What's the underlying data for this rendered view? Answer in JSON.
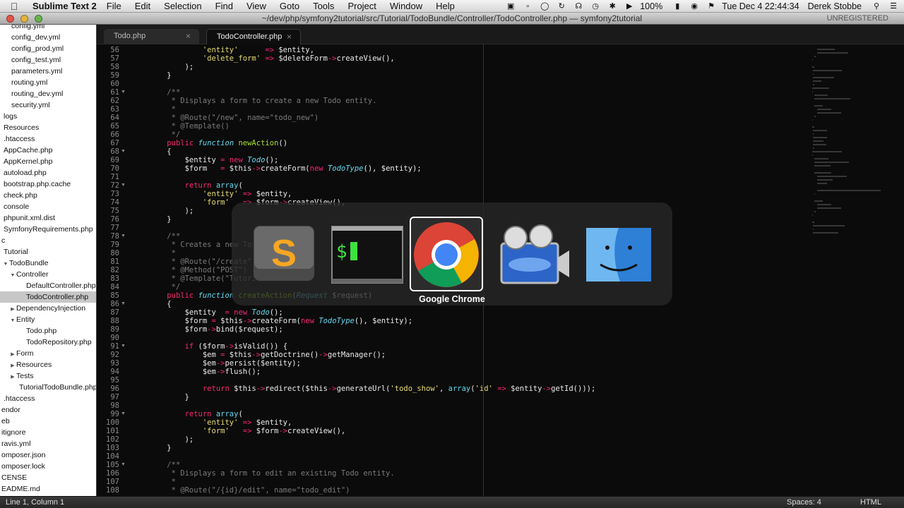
{
  "menubar": {
    "app_name": "Sublime Text 2",
    "items": [
      "File",
      "Edit",
      "Selection",
      "Find",
      "View",
      "Goto",
      "Tools",
      "Project",
      "Window",
      "Help"
    ],
    "battery": "100%",
    "clock": "Tue Dec 4  22:44:34",
    "user": "Derek Stobbe"
  },
  "window": {
    "title": "~/dev/php/symfony2tutorial/src/Tutorial/TodoBundle/Controller/TodoController.php — symfony2tutorial",
    "license": "UNREGISTERED"
  },
  "sidebar": {
    "items": [
      {
        "label": "config.yml",
        "indent": 16,
        "arrow": ""
      },
      {
        "label": "config_dev.yml",
        "indent": 16,
        "arrow": ""
      },
      {
        "label": "config_prod.yml",
        "indent": 16,
        "arrow": ""
      },
      {
        "label": "config_test.yml",
        "indent": 16,
        "arrow": ""
      },
      {
        "label": "parameters.yml",
        "indent": 16,
        "arrow": ""
      },
      {
        "label": "routing.yml",
        "indent": 16,
        "arrow": ""
      },
      {
        "label": "routing_dev.yml",
        "indent": 16,
        "arrow": ""
      },
      {
        "label": "security.yml",
        "indent": 16,
        "arrow": ""
      },
      {
        "label": "logs",
        "indent": 5,
        "arrow": ""
      },
      {
        "label": "Resources",
        "indent": 5,
        "arrow": ""
      },
      {
        "label": ".htaccess",
        "indent": 5,
        "arrow": ""
      },
      {
        "label": "AppCache.php",
        "indent": 5,
        "arrow": ""
      },
      {
        "label": "AppKernel.php",
        "indent": 5,
        "arrow": ""
      },
      {
        "label": "autoload.php",
        "indent": 5,
        "arrow": ""
      },
      {
        "label": "bootstrap.php.cache",
        "indent": 5,
        "arrow": ""
      },
      {
        "label": "check.php",
        "indent": 5,
        "arrow": ""
      },
      {
        "label": "console",
        "indent": 5,
        "arrow": ""
      },
      {
        "label": "phpunit.xml.dist",
        "indent": 5,
        "arrow": ""
      },
      {
        "label": "SymfonyRequirements.php",
        "indent": 5,
        "arrow": ""
      },
      {
        "label": "c",
        "indent": 2,
        "arrow": ""
      },
      {
        "label": "Tutorial",
        "indent": 5,
        "arrow": ""
      },
      {
        "label": "TodoBundle",
        "indent": 3,
        "arrow": "▼"
      },
      {
        "label": "Controller",
        "indent": 13,
        "arrow": "▼"
      },
      {
        "label": "DefaultController.php",
        "indent": 37,
        "arrow": ""
      },
      {
        "label": "TodoController.php",
        "indent": 37,
        "arrow": "",
        "selected": true
      },
      {
        "label": "DependencyInjection",
        "indent": 13,
        "arrow": "▶"
      },
      {
        "label": "Entity",
        "indent": 13,
        "arrow": "▼"
      },
      {
        "label": "Todo.php",
        "indent": 37,
        "arrow": ""
      },
      {
        "label": "TodoRepository.php",
        "indent": 37,
        "arrow": ""
      },
      {
        "label": "Form",
        "indent": 13,
        "arrow": "▶"
      },
      {
        "label": "Resources",
        "indent": 13,
        "arrow": "▶"
      },
      {
        "label": "Tests",
        "indent": 13,
        "arrow": "▶"
      },
      {
        "label": "TutorialTodoBundle.php",
        "indent": 27,
        "arrow": ""
      },
      {
        "label": ".htaccess",
        "indent": 5,
        "arrow": ""
      },
      {
        "label": "endor",
        "indent": 2,
        "arrow": ""
      },
      {
        "label": "eb",
        "indent": 2,
        "arrow": ""
      },
      {
        "label": "itignore",
        "indent": 2,
        "arrow": ""
      },
      {
        "label": "ravis.yml",
        "indent": 2,
        "arrow": ""
      },
      {
        "label": "omposer.json",
        "indent": 2,
        "arrow": ""
      },
      {
        "label": "omposer.lock",
        "indent": 2,
        "arrow": ""
      },
      {
        "label": "CENSE",
        "indent": 2,
        "arrow": ""
      },
      {
        "label": "EADME.md",
        "indent": 2,
        "arrow": ""
      }
    ]
  },
  "tabs": [
    {
      "label": "Todo.php",
      "close": "×"
    },
    {
      "label": "TodoController.php",
      "close": "×"
    }
  ],
  "code_lines": [
    {
      "n": "56",
      "fold": "",
      "html": "            <span class=\"sg\">'entity'</span>      <span class=\"kw\">=&gt;</span> $entity,"
    },
    {
      "n": "57",
      "fold": "",
      "html": "            <span class=\"sg\">'delete_form'</span> <span class=\"kw\">=&gt;</span> $deleteForm<span class=\"kw\">-&gt;</span>createView(),"
    },
    {
      "n": "58",
      "fold": "",
      "html": "        );"
    },
    {
      "n": "59",
      "fold": "",
      "html": "    }"
    },
    {
      "n": "60",
      "fold": "",
      "html": ""
    },
    {
      "n": "61",
      "fold": "▼",
      "html": "    <span class=\"cm\">/**</span>"
    },
    {
      "n": "62",
      "fold": "",
      "html": "<span class=\"cm\">     * Displays a form to create a new Todo entity.</span>"
    },
    {
      "n": "63",
      "fold": "",
      "html": "<span class=\"cm\">     *</span>"
    },
    {
      "n": "64",
      "fold": "",
      "html": "<span class=\"cm\">     * @Route(\"/new\", name=\"todo_new\")</span>"
    },
    {
      "n": "65",
      "fold": "",
      "html": "<span class=\"cm\">     * @Template()</span>"
    },
    {
      "n": "66",
      "fold": "",
      "html": "<span class=\"cm\">     */</span>"
    },
    {
      "n": "67",
      "fold": "",
      "html": "    <span class=\"kw\">public</span> <span class=\"it\">function</span> <span class=\"fn\">newAction</span>()"
    },
    {
      "n": "68",
      "fold": "▼",
      "html": "    {"
    },
    {
      "n": "69",
      "fold": "",
      "html": "        $entity <span class=\"kw\">=</span> <span class=\"kw\">new</span> <span class=\"it\">Todo</span>();"
    },
    {
      "n": "70",
      "fold": "",
      "html": "        $form   <span class=\"kw\">=</span> $this<span class=\"kw\">-&gt;</span>createForm(<span class=\"kw\">new</span> <span class=\"it\">TodoType</span>(), $entity);"
    },
    {
      "n": "71",
      "fold": "",
      "html": ""
    },
    {
      "n": "72",
      "fold": "▼",
      "html": "        <span class=\"kw\">return</span> <span class=\"ty\">array</span>("
    },
    {
      "n": "73",
      "fold": "",
      "html": "            <span class=\"sg\">'entity'</span> <span class=\"kw\">=&gt;</span> $entity,"
    },
    {
      "n": "74",
      "fold": "",
      "html": "            <span class=\"sg\">'form'</span>   <span class=\"kw\">=&gt;</span> $form<span class=\"kw\">-&gt;</span>createView(),"
    },
    {
      "n": "75",
      "fold": "",
      "html": "        );"
    },
    {
      "n": "76",
      "fold": "",
      "html": "    }"
    },
    {
      "n": "77",
      "fold": "",
      "html": ""
    },
    {
      "n": "78",
      "fold": "▼",
      "html": "    <span class=\"cm\">/**</span>"
    },
    {
      "n": "79",
      "fold": "",
      "html": "<span class=\"cm\">     * Creates a new Todo e</span>"
    },
    {
      "n": "80",
      "fold": "",
      "html": "<span class=\"cm\">     *</span>"
    },
    {
      "n": "81",
      "fold": "",
      "html": "<span class=\"cm\">     * @Route(\"/create\", na</span>"
    },
    {
      "n": "82",
      "fold": "",
      "html": "<span class=\"cm\">     * @Method(\"POST\")</span>"
    },
    {
      "n": "83",
      "fold": "",
      "html": "<span class=\"cm\">     * @Template(\"Tutorial</span>"
    },
    {
      "n": "84",
      "fold": "",
      "html": "<span class=\"cm\">     */</span>"
    },
    {
      "n": "85",
      "fold": "",
      "html": "    <span class=\"kw\">public</span> <span class=\"it\">function</span> <span class=\"fn\">createAction</span>(<span class=\"it\">Request</span> $request)"
    },
    {
      "n": "86",
      "fold": "▼",
      "html": "    {"
    },
    {
      "n": "87",
      "fold": "",
      "html": "        $entity  <span class=\"kw\">=</span> <span class=\"kw\">new</span> <span class=\"it\">Todo</span>();"
    },
    {
      "n": "88",
      "fold": "",
      "html": "        $form <span class=\"kw\">=</span> $this<span class=\"kw\">-&gt;</span>createForm(<span class=\"kw\">new</span> <span class=\"it\">TodoType</span>(), $entity);"
    },
    {
      "n": "89",
      "fold": "",
      "html": "        $form<span class=\"kw\">-&gt;</span>bind($request);"
    },
    {
      "n": "90",
      "fold": "",
      "html": ""
    },
    {
      "n": "91",
      "fold": "▼",
      "html": "        <span class=\"kw\">if</span> ($form<span class=\"kw\">-&gt;</span>isValid()) {"
    },
    {
      "n": "92",
      "fold": "",
      "html": "            $em <span class=\"kw\">=</span> $this<span class=\"kw\">-&gt;</span>getDoctrine()<span class=\"kw\">-&gt;</span>getManager();"
    },
    {
      "n": "93",
      "fold": "",
      "html": "            $em<span class=\"kw\">-&gt;</span>persist($entity);"
    },
    {
      "n": "94",
      "fold": "",
      "html": "            $em<span class=\"kw\">-&gt;</span>flush();"
    },
    {
      "n": "95",
      "fold": "",
      "html": ""
    },
    {
      "n": "96",
      "fold": "",
      "html": "            <span class=\"kw\">return</span> $this<span class=\"kw\">-&gt;</span>redirect($this<span class=\"kw\">-&gt;</span>generateUrl(<span class=\"sg\">'todo_show'</span>, <span class=\"ty\">array</span>(<span class=\"sg\">'id'</span> <span class=\"kw\">=&gt;</span> $entity<span class=\"kw\">-&gt;</span>getId()));"
    },
    {
      "n": "97",
      "fold": "",
      "html": "        }"
    },
    {
      "n": "98",
      "fold": "",
      "html": ""
    },
    {
      "n": "99",
      "fold": "▼",
      "html": "        <span class=\"kw\">return</span> <span class=\"ty\">array</span>("
    },
    {
      "n": "100",
      "fold": "",
      "html": "            <span class=\"sg\">'entity'</span> <span class=\"kw\">=&gt;</span> $entity,"
    },
    {
      "n": "101",
      "fold": "",
      "html": "            <span class=\"sg\">'form'</span>   <span class=\"kw\">=&gt;</span> $form<span class=\"kw\">-&gt;</span>createView(),"
    },
    {
      "n": "102",
      "fold": "",
      "html": "        );"
    },
    {
      "n": "103",
      "fold": "",
      "html": "    }"
    },
    {
      "n": "104",
      "fold": "",
      "html": ""
    },
    {
      "n": "105",
      "fold": "▼",
      "html": "    <span class=\"cm\">/**</span>"
    },
    {
      "n": "106",
      "fold": "",
      "html": "<span class=\"cm\">     * Displays a form to edit an existing Todo entity.</span>"
    },
    {
      "n": "107",
      "fold": "",
      "html": "<span class=\"cm\">     *</span>"
    },
    {
      "n": "108",
      "fold": "",
      "html": "<span class=\"cm\">     * @Route(\"/{id}/edit\", name=\"todo_edit\")</span>"
    }
  ],
  "statusbar": {
    "position": "Line 1, Column 1",
    "spaces": "Spaces: 4",
    "syntax": "HTML"
  },
  "app_switcher": {
    "apps": [
      "sublime-text-icon",
      "terminal-icon",
      "google-chrome-icon",
      "video-app-icon",
      "finder-icon"
    ],
    "selected_label": "Google Chrome"
  }
}
